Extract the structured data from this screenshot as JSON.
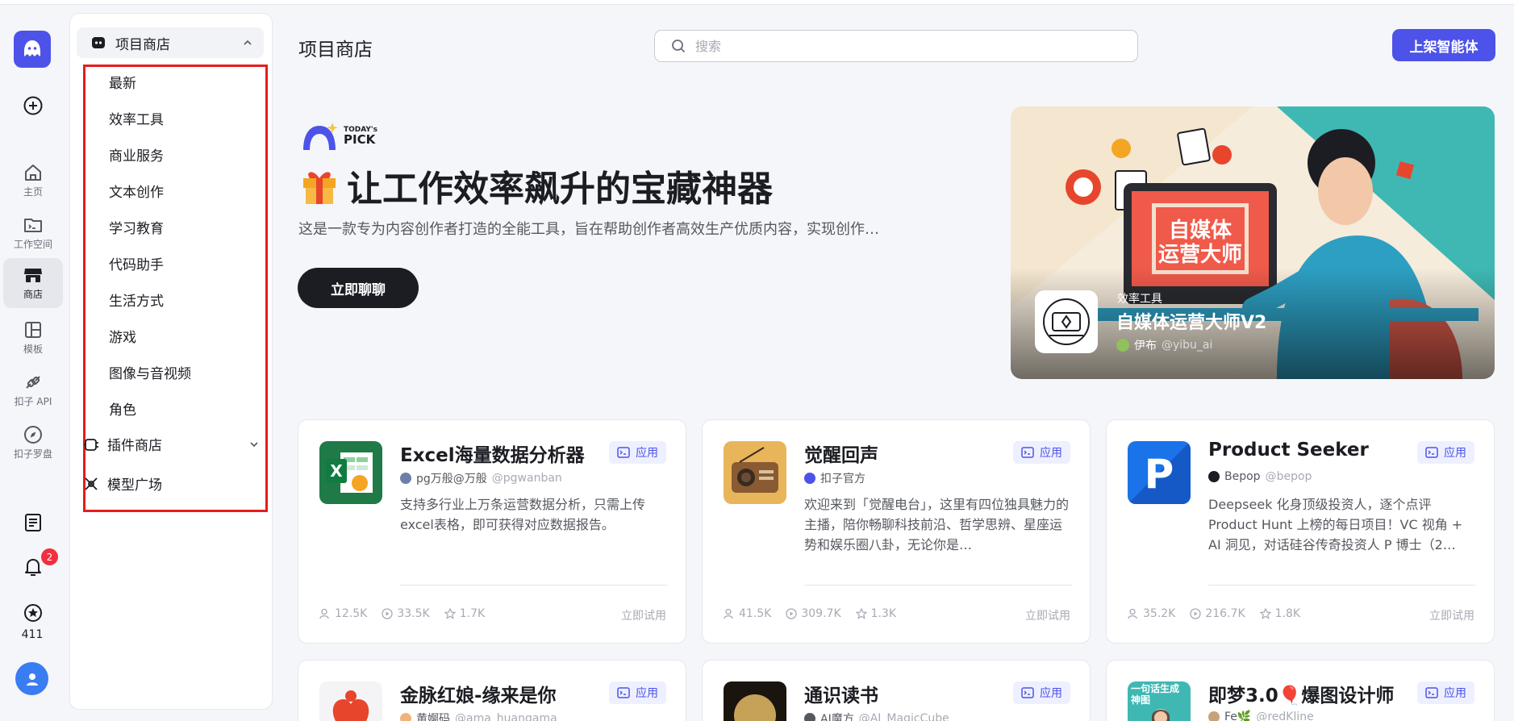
{
  "rail": {
    "items": [
      {
        "label": "主页",
        "icon": "home-icon"
      },
      {
        "label": "工作空间",
        "icon": "workspace-icon"
      },
      {
        "label": "商店",
        "icon": "store-icon",
        "active": true
      },
      {
        "label": "模板",
        "icon": "template-icon"
      },
      {
        "label": "扣子 API",
        "icon": "api-icon"
      },
      {
        "label": "扣子罗盘",
        "icon": "compass-icon"
      }
    ],
    "notification_count": "2",
    "points": "411"
  },
  "subnav": {
    "section_title": "项目商店",
    "categories": [
      "最新",
      "效率工具",
      "商业服务",
      "文本创作",
      "学习教育",
      "代码助手",
      "生活方式",
      "游戏",
      "图像与音视频",
      "角色"
    ],
    "plugin_store": "插件商店",
    "model_square": "模型广场"
  },
  "header": {
    "title": "项目商店",
    "search_placeholder": "搜索",
    "publish_label": "上架智能体"
  },
  "hero": {
    "pick_line1": "TODAY's",
    "pick_line2": "PICK",
    "title": "让工作效率飙升的宝藏神器",
    "description": "这是一款专为内容创作者打造的全能工具，旨在帮助创作者高效生产优质内容，实现创作…",
    "cta": "立即聊聊",
    "banner": {
      "screen_line1": "自媒体",
      "screen_line2": "运营大师",
      "category": "效率工具",
      "name": "自媒体运营大师V2",
      "author": "伊布",
      "handle": "@yibu_ai"
    }
  },
  "cards": [
    {
      "name": "Excel海量数据分析器",
      "tag": "应用",
      "author": "pg万般@万般",
      "handle": "@pgwanban",
      "desc": "支持多行业上万条运营数据分析，只需上传excel表格，即可获得对应数据报告。",
      "users": "12.5K",
      "runs": "33.5K",
      "stars": "1.7K",
      "try": "立即试用"
    },
    {
      "name": "觉醒回声",
      "tag": "应用",
      "author": "扣子官方",
      "handle": "",
      "desc": "欢迎来到「觉醒电台」，这里有四位独具魅力的主播，陪你畅聊科技前沿、哲学思辨、星座运势和娱乐圈八卦，无论你是…",
      "users": "41.5K",
      "runs": "309.7K",
      "stars": "1.3K",
      "try": "立即试用"
    },
    {
      "name": "Product Seeker",
      "tag": "应用",
      "author": "Bepop",
      "handle": "@bepop",
      "desc": "Deepseek 化身顶级投资人，逐个点评 Product Hunt 上榜的每日项目！VC 视角 + AI 洞见，对话硅谷传奇投资人 P 博士（2…",
      "users": "35.2K",
      "runs": "216.7K",
      "stars": "1.8K",
      "try": "立即试用"
    },
    {
      "name": "金脉红娘-缘来是你",
      "tag": "应用",
      "author": "黄婀码",
      "handle": "@ama_huangama"
    },
    {
      "name": "通识读书",
      "tag": "应用",
      "author": "AI魔方",
      "handle": "@AI_MagicCube"
    },
    {
      "name": "即梦3.0🎈爆图设计师",
      "tag": "应用",
      "author": "Fe🌿",
      "handle": "@redKline",
      "thumb_text": "一句话生成神图"
    }
  ]
}
